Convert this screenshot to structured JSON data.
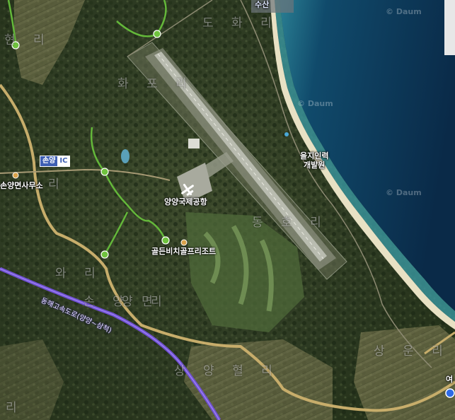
{
  "map": {
    "type": "satellite",
    "watermark": "© Daum"
  },
  "labels": {
    "district": [
      "도 화 리",
      "화 포 리",
      "동 호 리",
      "손 양 면",
      "양 리",
      "상 운 리",
      "와 리",
      "상 양 혈 리",
      "현 리",
      "리",
      "리",
      "수산",
      "여"
    ],
    "poi": {
      "airport": "양양국제공항",
      "research": "을지인력\n개발원",
      "golf": "골든비치골프리조트",
      "office": "손양면사무소"
    },
    "ic": {
      "name": "손양",
      "tag": "IC"
    },
    "highway": "동해고속도로(양양~삼척)"
  },
  "colors": {
    "sea_deep": "#0b2c4b",
    "sea_shallow": "#3f9aa8",
    "beach": "#e9e2c8",
    "road": "#c9ae6c",
    "highway": "#7a55d6",
    "trail": "#6bbf3a"
  }
}
